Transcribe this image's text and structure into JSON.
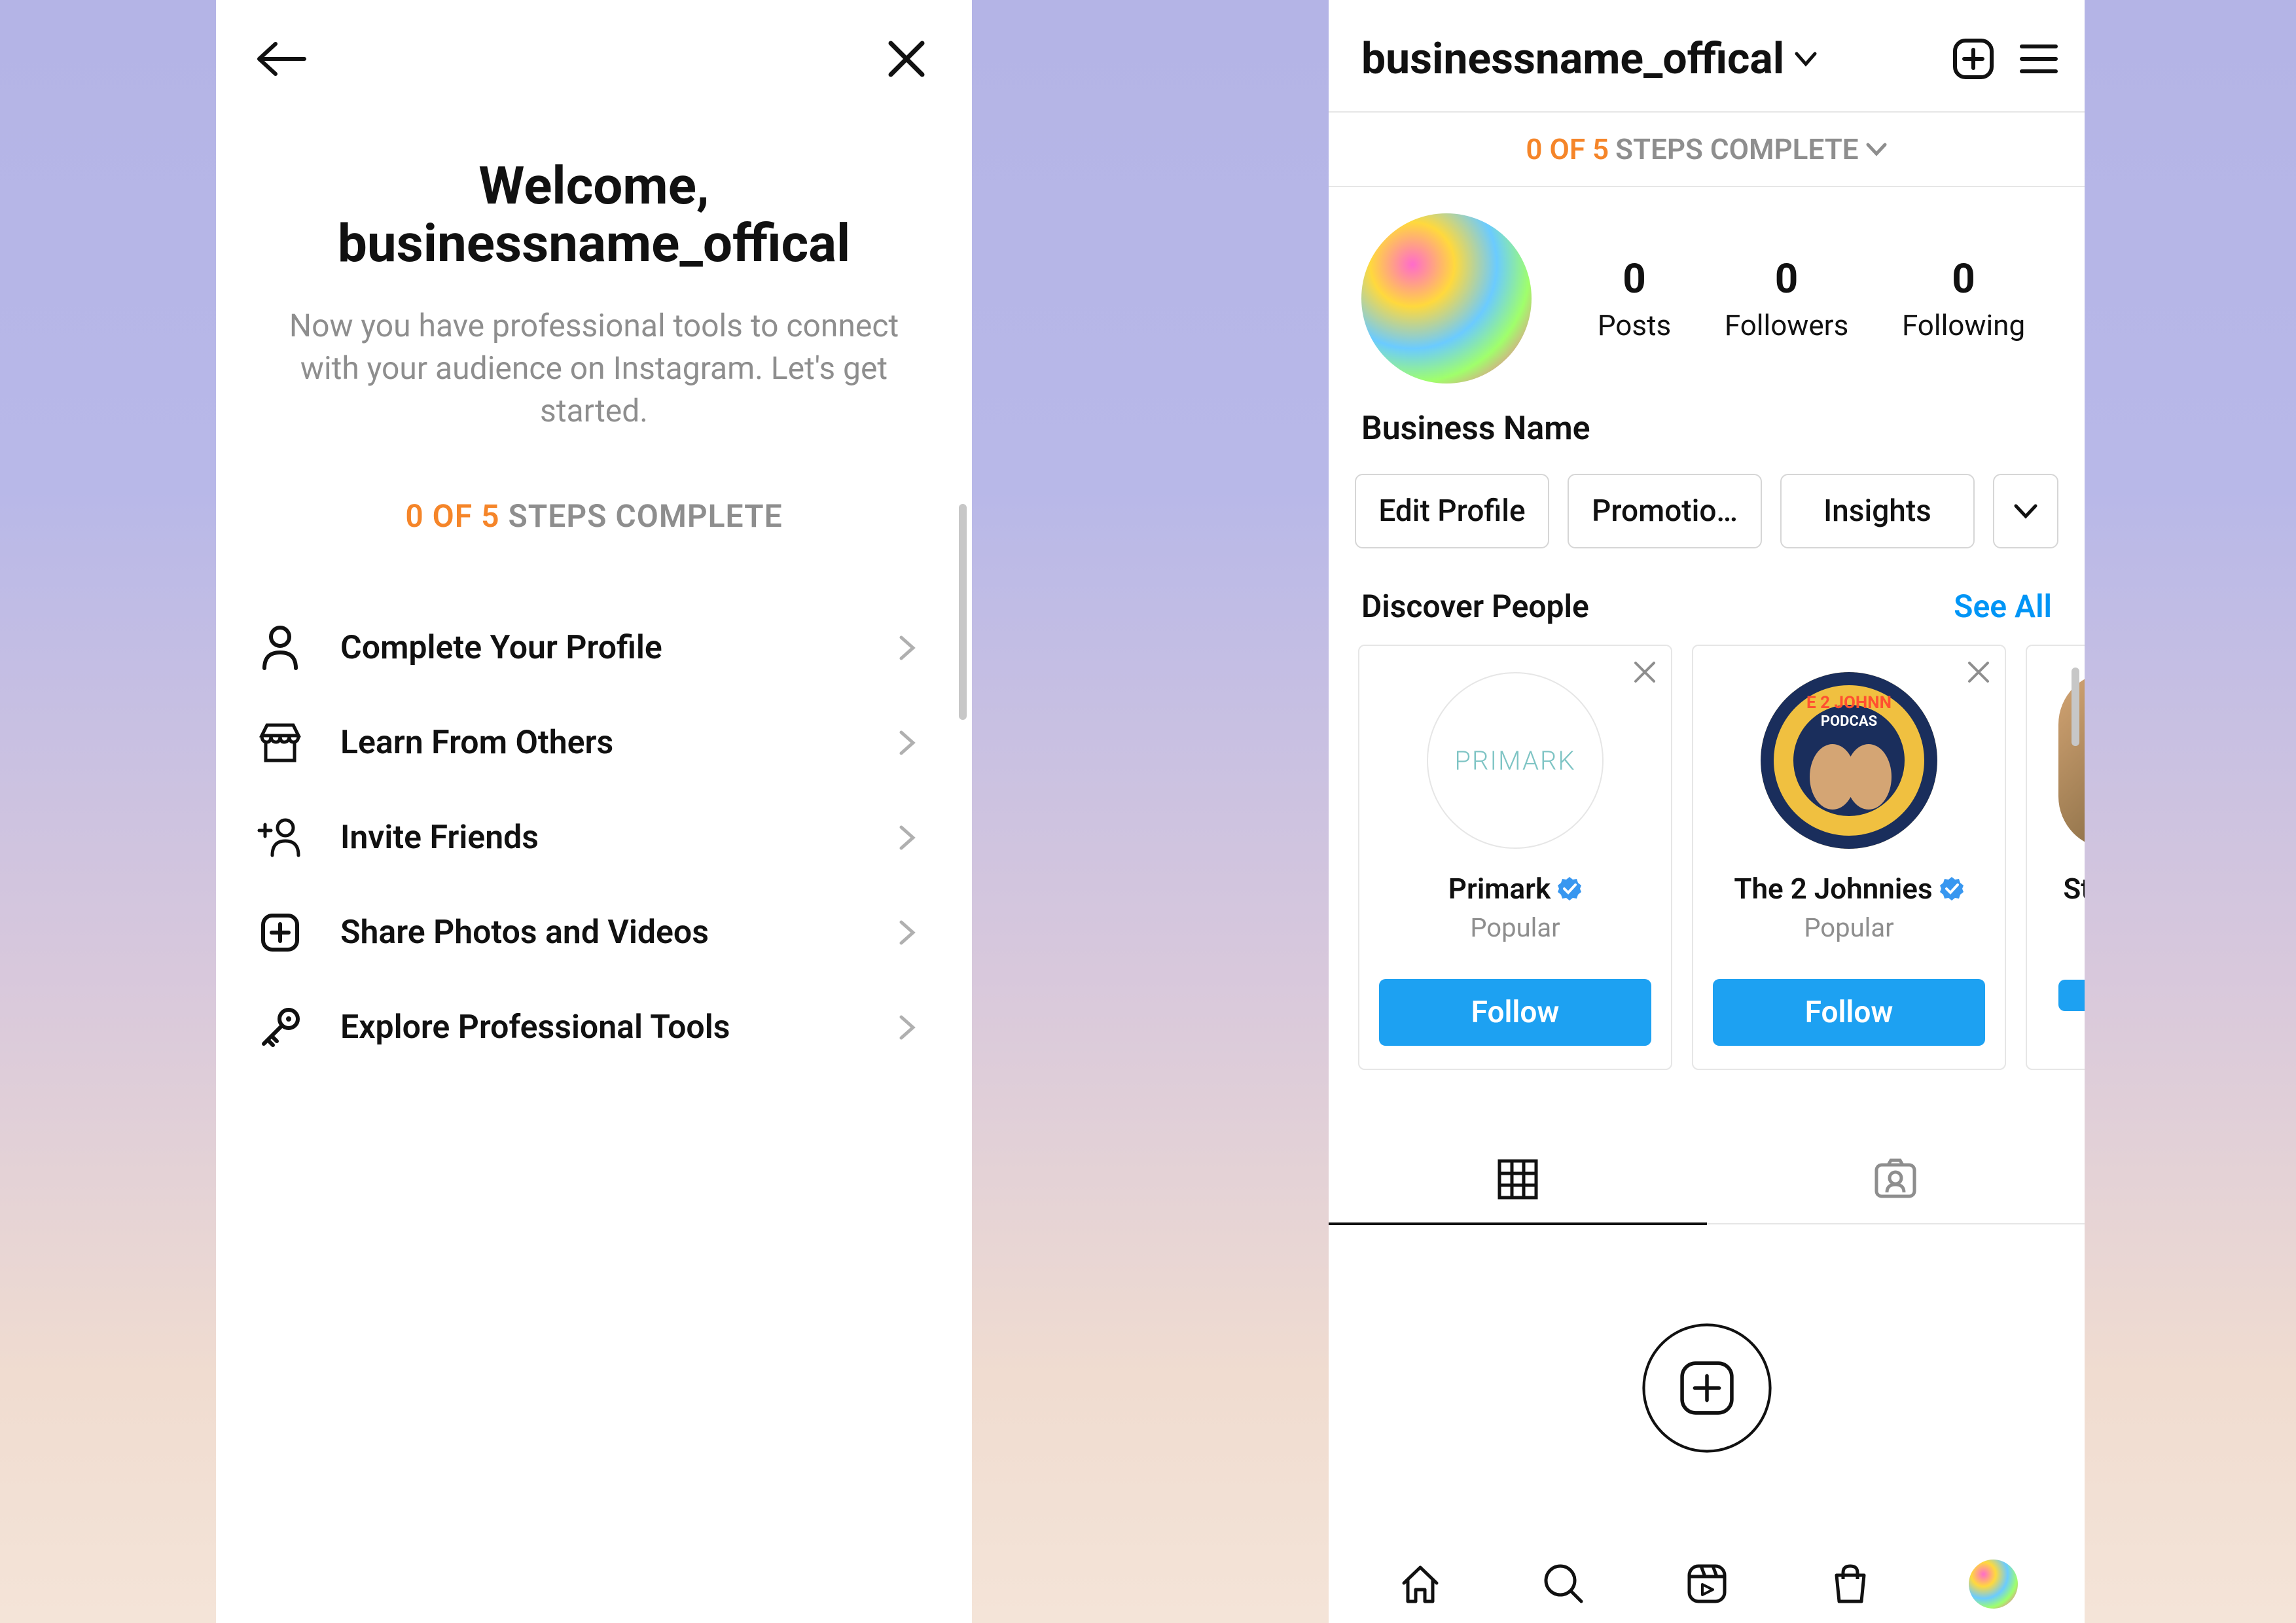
{
  "left": {
    "welcome_prefix": "Welcome,",
    "username": "businessname_offical",
    "subtitle": "Now you have professional tools to connect with your audience on Instagram. Let's get started.",
    "steps_count": "0 OF 5",
    "steps_suffix": "STEPS COMPLETE",
    "items": [
      {
        "label": "Complete Your Profile",
        "icon": "person"
      },
      {
        "label": "Learn From Others",
        "icon": "storefront"
      },
      {
        "label": "Invite Friends",
        "icon": "person-add"
      },
      {
        "label": "Share Photos and Videos",
        "icon": "plus-square"
      },
      {
        "label": "Explore Professional Tools",
        "icon": "key"
      }
    ]
  },
  "right": {
    "username": "businessname_offical",
    "banner_count": "0 OF 5",
    "banner_suffix": "STEPS COMPLETE",
    "stats": {
      "posts": {
        "value": "0",
        "label": "Posts"
      },
      "followers": {
        "value": "0",
        "label": "Followers"
      },
      "following": {
        "value": "0",
        "label": "Following"
      }
    },
    "display_name": "Business Name",
    "actions": {
      "edit": "Edit Profile",
      "promotions": "Promotio…",
      "insights": "Insights"
    },
    "discover": {
      "title": "Discover People",
      "see_all": "See All",
      "cards": [
        {
          "name": "Primark",
          "subtitle": "Popular",
          "follow": "Follow",
          "avatar_text": "PRIMARK"
        },
        {
          "name": "The 2 Johnnies",
          "subtitle": "Popular",
          "follow": "Follow"
        },
        {
          "name": "Sta",
          "subtitle": "",
          "follow": ""
        }
      ]
    }
  }
}
